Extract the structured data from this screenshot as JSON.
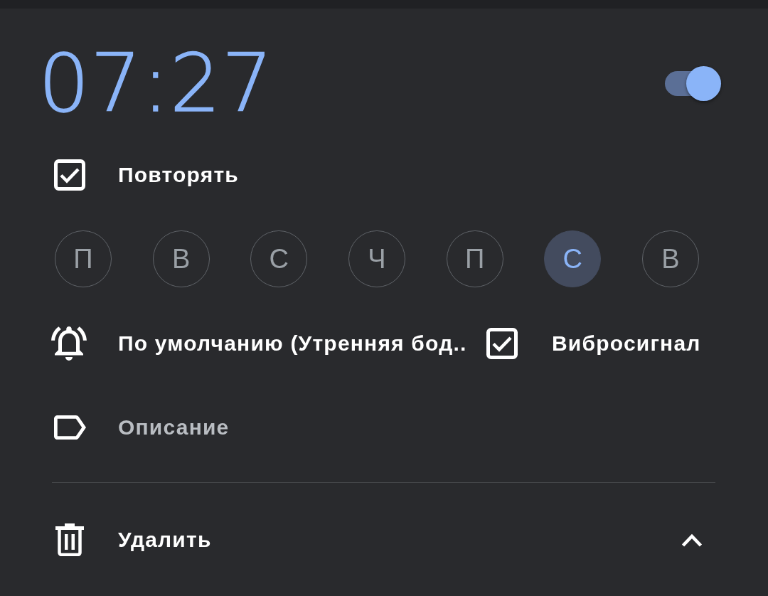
{
  "alarm": {
    "time": "07:27",
    "enabled": true
  },
  "repeat": {
    "label": "Повторять",
    "checked": true
  },
  "days": [
    {
      "label": "П",
      "selected": false
    },
    {
      "label": "В",
      "selected": false
    },
    {
      "label": "С",
      "selected": false
    },
    {
      "label": "Ч",
      "selected": false
    },
    {
      "label": "П",
      "selected": false
    },
    {
      "label": "С",
      "selected": true
    },
    {
      "label": "В",
      "selected": false
    }
  ],
  "ringtone": {
    "label": "По умолчанию (Утренняя бод.."
  },
  "vibrate": {
    "label": "Вибросигнал",
    "checked": true
  },
  "description": {
    "placeholder": "Описание"
  },
  "delete": {
    "label": "Удалить"
  },
  "collapse": {
    "expanded": true
  }
}
